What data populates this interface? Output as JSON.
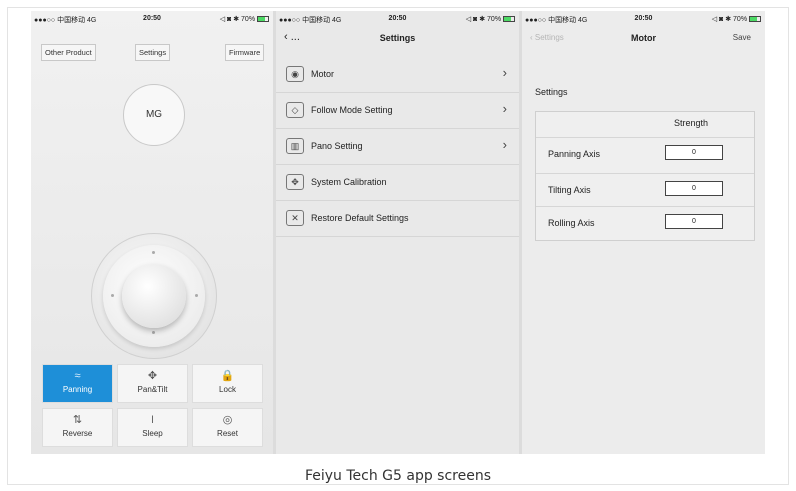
{
  "status_bar": {
    "carrier": "●●●○○ 中国移动  4G",
    "time": "20:50",
    "right": "◁ ◙ ✱ 70%"
  },
  "screen1": {
    "buttons": {
      "other_product": "Other Product",
      "settings": "Settings",
      "firmware": "Firmware"
    },
    "mg_label": "MG",
    "modes": [
      {
        "label": "Panning",
        "icon": "panning-icon",
        "glyph": "≈",
        "active": true
      },
      {
        "label": "Pan&Tilt",
        "icon": "pan-tilt-icon",
        "glyph": "✥",
        "active": false
      },
      {
        "label": "Lock",
        "icon": "lock-icon",
        "glyph": "🔒",
        "active": false
      },
      {
        "label": "Reverse",
        "icon": "reverse-icon",
        "glyph": "⇅",
        "active": false
      },
      {
        "label": "Sleep",
        "icon": "sleep-icon",
        "glyph": "⏽",
        "active": false
      },
      {
        "label": "Reset",
        "icon": "reset-icon",
        "glyph": "◎",
        "active": false
      }
    ],
    "active_color": "#1e8fd8"
  },
  "screen2": {
    "back": "‹ ...",
    "title": "Settings",
    "items": [
      {
        "label": "Motor",
        "icon": "motor-icon",
        "glyph": "◉",
        "chevron": "›"
      },
      {
        "label": "Follow Mode Setting",
        "icon": "follow-mode-icon",
        "glyph": "◇",
        "chevron": "›"
      },
      {
        "label": "Pano Setting",
        "icon": "pano-icon",
        "glyph": "▥",
        "chevron": "›"
      },
      {
        "label": "System Calibration",
        "icon": "calibration-icon",
        "glyph": "✥",
        "chevron": ""
      },
      {
        "label": "Restore Default Settings",
        "icon": "restore-icon",
        "glyph": "✕",
        "chevron": ""
      }
    ]
  },
  "screen3": {
    "back": "‹ Settings",
    "title": "Motor",
    "save": "Save",
    "section_label": "Settings",
    "strength_header": "Strength",
    "axes": [
      {
        "label": "Panning Axis",
        "value": "0"
      },
      {
        "label": "Tilting Axis",
        "value": "0"
      },
      {
        "label": "Rolling Axis",
        "value": "0"
      }
    ]
  },
  "caption": "Feiyu Tech G5 app screens"
}
